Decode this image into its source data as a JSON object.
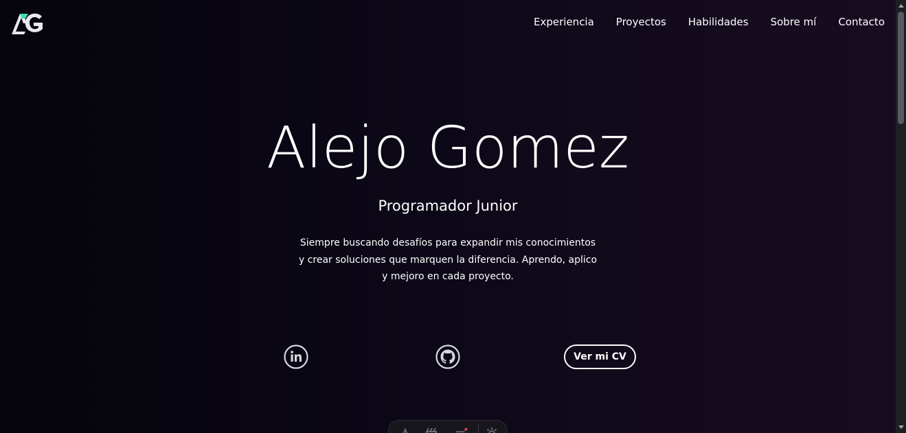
{
  "logo": {
    "text": "AG",
    "icon": "ag-logo-icon",
    "accent": "#3ddbb5"
  },
  "nav": {
    "items": [
      {
        "label": "Experiencia"
      },
      {
        "label": "Proyectos"
      },
      {
        "label": "Habilidades"
      },
      {
        "label": "Sobre mí"
      },
      {
        "label": "Contacto"
      }
    ]
  },
  "hero": {
    "name": "Alejo Gomez",
    "role": "Programador Junior",
    "description": [
      "Siempre buscando desafíos para expandir mis conocimientos",
      "y crear soluciones que marquen la diferencia. Aprendo, aplico",
      "y mejoro en cada proyecto."
    ]
  },
  "social": {
    "linkedin_icon": "linkedin-icon",
    "github_icon": "github-icon",
    "cv_label": "Ver mi CV"
  },
  "dock": {
    "icons": [
      "logo-icon",
      "clapperboard-icon",
      "menu-icon",
      "settings-icon"
    ]
  },
  "colors": {
    "background_left": "#05040b",
    "background_right": "#180d20",
    "text": "#ffffff"
  }
}
